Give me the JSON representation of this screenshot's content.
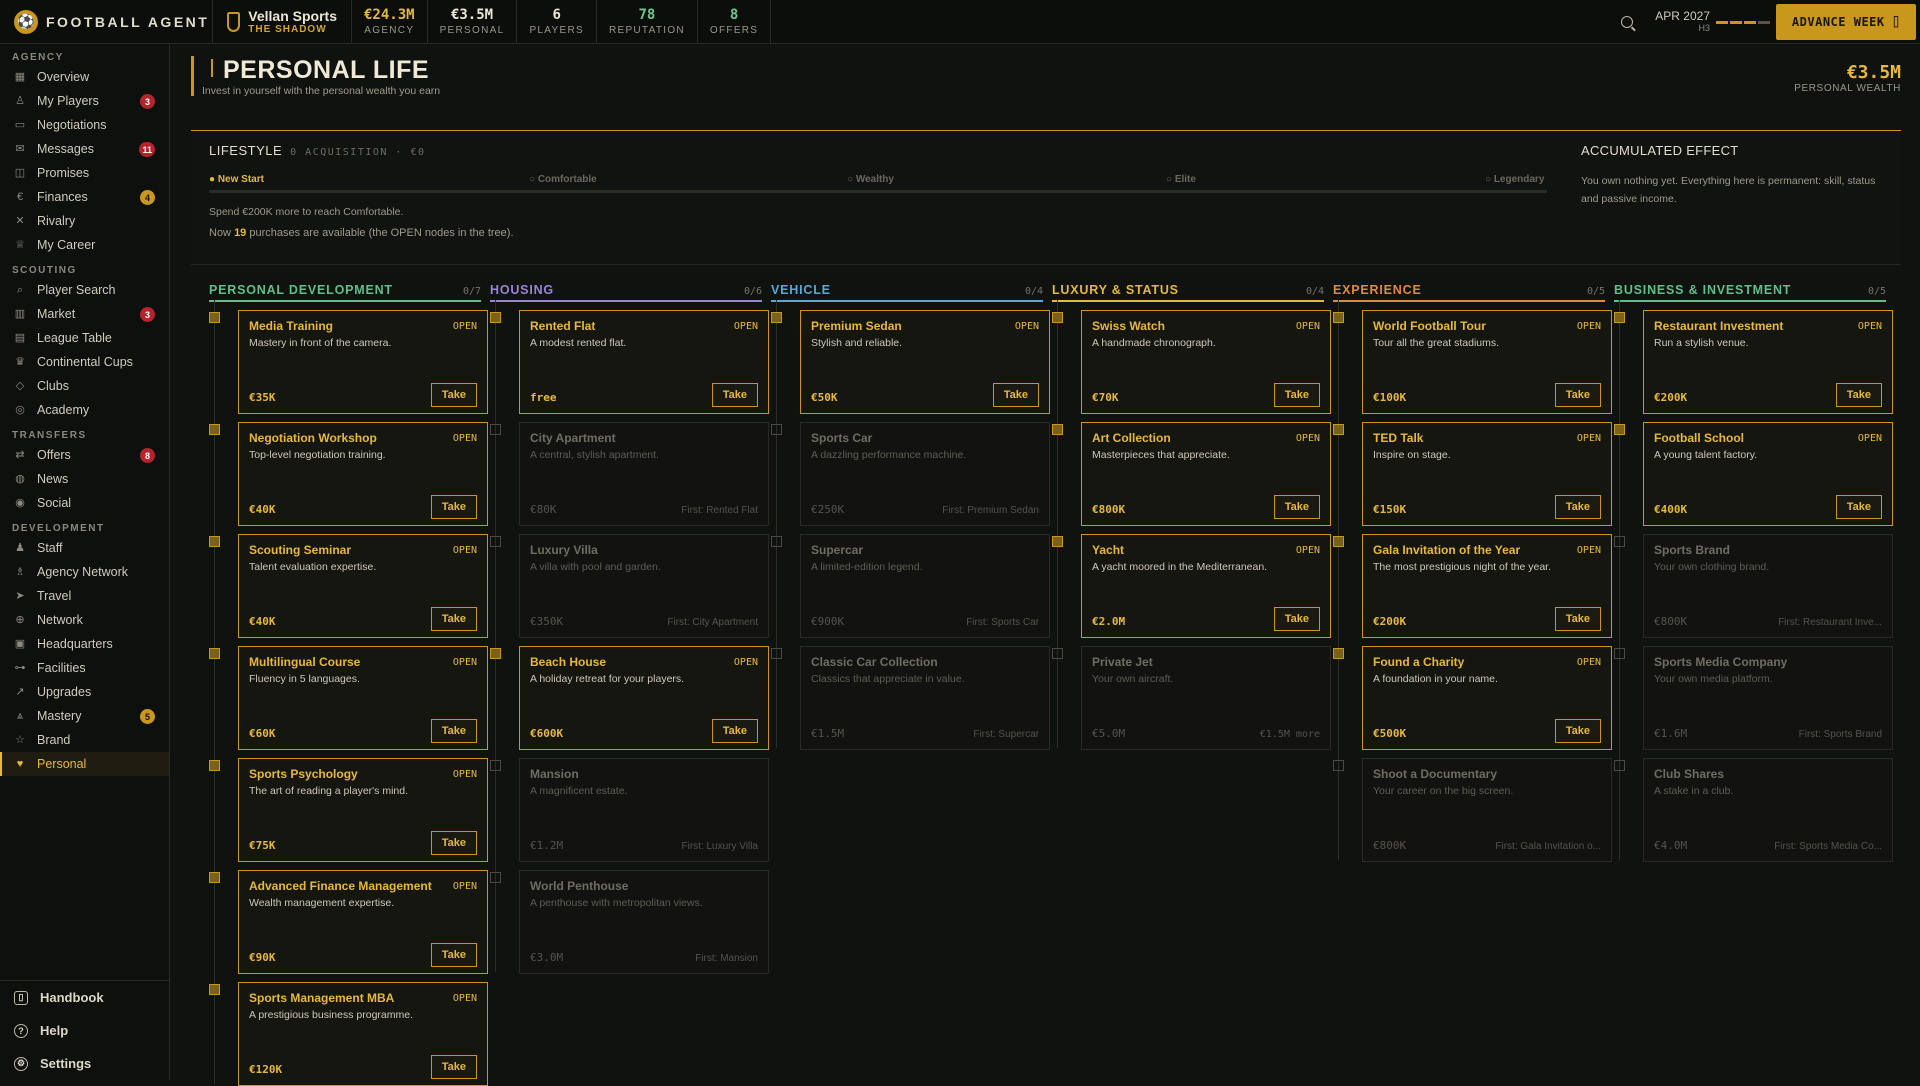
{
  "app": {
    "name": "FOOTBALL AGENT",
    "team": "Vellan Sports",
    "team_sub": "THE SHADOW"
  },
  "stats": [
    {
      "value": "€24.3M",
      "label": "AGENCY",
      "color": "#e7b93a"
    },
    {
      "value": "€3.5M",
      "label": "PERSONAL",
      "color": "#ece6d4"
    },
    {
      "value": "6",
      "label": "PLAYERS",
      "color": "#ece6d4"
    },
    {
      "value": "78",
      "label": "REPUTATION",
      "color": "#6fc58c"
    },
    {
      "value": "8",
      "label": "OFFERS",
      "color": "#6fc58c"
    }
  ],
  "topright": {
    "date": "APR 2027",
    "half": "H3",
    "advance": "ADVANCE WEEK ⌷"
  },
  "sidebar": {
    "sections": [
      {
        "title": "AGENCY",
        "items": [
          {
            "label": "Overview",
            "icon": "▦",
            "name": "overview"
          },
          {
            "label": "My Players",
            "icon": "♙",
            "name": "my-players",
            "badge": "3",
            "badge_color": "red"
          },
          {
            "label": "Negotiations",
            "icon": "▭",
            "name": "negotiations"
          },
          {
            "label": "Messages",
            "icon": "✉",
            "name": "messages",
            "badge": "11",
            "badge_color": "red"
          },
          {
            "label": "Promises",
            "icon": "◫",
            "name": "promises"
          },
          {
            "label": "Finances",
            "icon": "€",
            "name": "finances",
            "badge": "4",
            "badge_color": "gold"
          },
          {
            "label": "Rivalry",
            "icon": "✕",
            "name": "rivalry"
          },
          {
            "label": "My Career",
            "icon": "♕",
            "name": "my-career"
          }
        ]
      },
      {
        "title": "SCOUTING",
        "items": [
          {
            "label": "Player Search",
            "icon": "⌕",
            "name": "player-search"
          },
          {
            "label": "Market",
            "icon": "▥",
            "name": "market",
            "badge": "3",
            "badge_color": "red"
          },
          {
            "label": "League Table",
            "icon": "▤",
            "name": "league-table"
          },
          {
            "label": "Continental Cups",
            "icon": "♛",
            "name": "continental-cups"
          },
          {
            "label": "Clubs",
            "icon": "◇",
            "name": "clubs"
          },
          {
            "label": "Academy",
            "icon": "◎",
            "name": "academy"
          }
        ]
      },
      {
        "title": "TRANSFERS",
        "items": [
          {
            "label": "Offers",
            "icon": "⇄",
            "name": "offers",
            "badge": "8",
            "badge_color": "red"
          },
          {
            "label": "News",
            "icon": "◍",
            "name": "news"
          },
          {
            "label": "Social",
            "icon": "◉",
            "name": "social"
          }
        ]
      },
      {
        "title": "DEVELOPMENT",
        "items": [
          {
            "label": "Staff",
            "icon": "♟",
            "name": "staff"
          },
          {
            "label": "Agency Network",
            "icon": "♗",
            "name": "agency-network"
          },
          {
            "label": "Travel",
            "icon": "➤",
            "name": "travel"
          },
          {
            "label": "Network",
            "icon": "⊕",
            "name": "network"
          },
          {
            "label": "Headquarters",
            "icon": "▣",
            "name": "headquarters"
          },
          {
            "label": "Facilities",
            "icon": "⊶",
            "name": "facilities"
          },
          {
            "label": "Upgrades",
            "icon": "↗",
            "name": "upgrades"
          },
          {
            "label": "Mastery",
            "icon": "⩓",
            "name": "mastery",
            "badge": "5",
            "badge_color": "gold"
          },
          {
            "label": "Brand",
            "icon": "☆",
            "name": "brand"
          },
          {
            "label": "Personal",
            "icon": "♥",
            "name": "personal",
            "active": true
          }
        ]
      }
    ],
    "bottom": [
      {
        "label": "Handbook",
        "icon": "▯",
        "name": "handbook"
      },
      {
        "label": "Help",
        "icon": "?",
        "name": "help"
      },
      {
        "label": "Settings",
        "icon": "⚙",
        "name": "settings"
      }
    ]
  },
  "page": {
    "title": "PERSONAL LIFE",
    "subtitle": "Invest in yourself with the personal wealth you earn",
    "wealth": "€3.5M",
    "wealth_label": "PERSONAL WEALTH"
  },
  "lifestyle": {
    "title": "LIFESTYLE",
    "meta": "0 ACQUISITION · €0",
    "tiers": [
      {
        "label": "● New Start",
        "active": true
      },
      {
        "label": "○ Comfortable"
      },
      {
        "label": "○ Wealthy"
      },
      {
        "label": "○ Elite"
      },
      {
        "label": "○ Legendary"
      }
    ],
    "note": "Spend €200K more to reach Comfortable.",
    "avail_pre": "Now ",
    "avail_num": "19",
    "avail_post": " purchases are available (the OPEN nodes in the tree).",
    "acc_title": "ACCUMULATED EFFECT",
    "acc_text": "You own nothing yet. Everything here is permanent: skill, status and passive income."
  },
  "columns": [
    {
      "name": "PERSONAL DEVELOPMENT",
      "count": "0/7",
      "color": "#5fbf8a",
      "nodes": [
        {
          "title": "Media Training",
          "desc": "Mastery in front of the camera.",
          "price": "€35K",
          "open": true
        },
        {
          "title": "Negotiation Workshop",
          "desc": "Top-level negotiation training.",
          "price": "€40K",
          "open": true
        },
        {
          "title": "Scouting Seminar",
          "desc": "Talent evaluation expertise.",
          "price": "€40K",
          "open": true
        },
        {
          "title": "Multilingual Course",
          "desc": "Fluency in 5 languages.",
          "price": "€60K",
          "open": true
        },
        {
          "title": "Sports Psychology",
          "desc": "The art of reading a player's mind.",
          "price": "€75K",
          "open": true
        },
        {
          "title": "Advanced Finance Management",
          "desc": "Wealth management expertise.",
          "price": "€90K",
          "open": true
        },
        {
          "title": "Sports Management MBA",
          "desc": "A prestigious business programme.",
          "price": "€120K",
          "open": true
        }
      ]
    },
    {
      "name": "HOUSING",
      "count": "0/6",
      "color": "#9a84d8",
      "nodes": [
        {
          "title": "Rented Flat",
          "desc": "A modest rented flat.",
          "price": "free",
          "open": true
        },
        {
          "title": "City Apartment",
          "desc": "A central, stylish apartment.",
          "price": "€80K",
          "req": "First: Rented Flat"
        },
        {
          "title": "Luxury Villa",
          "desc": "A villa with pool and garden.",
          "price": "€350K",
          "req": "First: City Apartment"
        },
        {
          "title": "Beach House",
          "desc": "A holiday retreat for your players.",
          "price": "€600K",
          "open": true
        },
        {
          "title": "Mansion",
          "desc": "A magnificent estate.",
          "price": "€1.2M",
          "req": "First: Luxury Villa"
        },
        {
          "title": "World Penthouse",
          "desc": "A penthouse with metropolitan views.",
          "price": "€3.0M",
          "req": "First: Mansion"
        }
      ]
    },
    {
      "name": "VEHICLE",
      "count": "0/4",
      "color": "#5aa8d8",
      "nodes": [
        {
          "title": "Premium Sedan",
          "desc": "Stylish and reliable.",
          "price": "€50K",
          "open": true
        },
        {
          "title": "Sports Car",
          "desc": "A dazzling performance machine.",
          "price": "€250K",
          "req": "First: Premium Sedan"
        },
        {
          "title": "Supercar",
          "desc": "A limited-edition legend.",
          "price": "€900K",
          "req": "First: Sports Car"
        },
        {
          "title": "Classic Car Collection",
          "desc": "Classics that appreciate in value.",
          "price": "€1.5M",
          "req": "First: Supercar"
        }
      ]
    },
    {
      "name": "LUXURY & STATUS",
      "count": "0/4",
      "color": "#e7b93a",
      "nodes": [
        {
          "title": "Swiss Watch",
          "desc": "A handmade chronograph.",
          "price": "€70K",
          "open": true
        },
        {
          "title": "Art Collection",
          "desc": "Masterpieces that appreciate.",
          "price": "€800K",
          "open": true
        },
        {
          "title": "Yacht",
          "desc": "A yacht moored in the Mediterranean.",
          "price": "€2.0M",
          "open": true
        },
        {
          "title": "Private Jet",
          "desc": "Your own aircraft.",
          "price": "€5.0M",
          "req": "€1.5M more",
          "req_mono": true
        }
      ]
    },
    {
      "name": "EXPERIENCE",
      "count": "0/5",
      "color": "#e08a3c",
      "nodes": [
        {
          "title": "World Football Tour",
          "desc": "Tour all the great stadiums.",
          "price": "€100K",
          "open": true
        },
        {
          "title": "TED Talk",
          "desc": "Inspire on stage.",
          "price": "€150K",
          "open": true
        },
        {
          "title": "Gala Invitation of the Year",
          "desc": "The most prestigious night of the year.",
          "price": "€200K",
          "open": true
        },
        {
          "title": "Found a Charity",
          "desc": "A foundation in your name.",
          "price": "€500K",
          "open": true
        },
        {
          "title": "Shoot a Documentary",
          "desc": "Your career on the big screen.",
          "price": "€800K",
          "req": "First: Gala Invitation o..."
        }
      ]
    },
    {
      "name": "BUSINESS & INVESTMENT",
      "count": "0/5",
      "color": "#5fbf8a",
      "nodes": [
        {
          "title": "Restaurant Investment",
          "desc": "Run a stylish venue.",
          "price": "€200K",
          "open": true
        },
        {
          "title": "Football School",
          "desc": "A young talent factory.",
          "price": "€400K",
          "open": true
        },
        {
          "title": "Sports Brand",
          "desc": "Your own clothing brand.",
          "price": "€800K",
          "req": "First: Restaurant Inve..."
        },
        {
          "title": "Sports Media Company",
          "desc": "Your own media platform.",
          "price": "€1.6M",
          "req": "First: Sports Brand"
        },
        {
          "title": "Club Shares",
          "desc": "A stake in a club.",
          "price": "€4.0M",
          "req": "First: Sports Media Co..."
        }
      ]
    }
  ],
  "labels": {
    "open": "OPEN",
    "take": "Take"
  }
}
